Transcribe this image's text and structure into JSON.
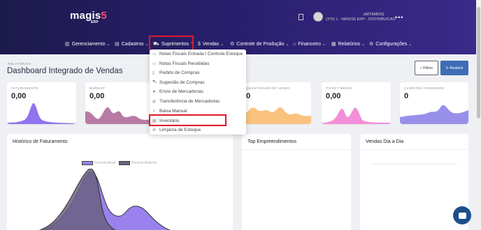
{
  "brand": {
    "name": "magis",
    "number": "5",
    "suffix": "ERP"
  },
  "user": {
    "name": "(ARTEMIOS)",
    "company": "(375) 1 - MAGIS5 ERP - DISTRIBUICAO"
  },
  "nav": [
    {
      "label": "Gerenciamento",
      "icon": "chart-icon"
    },
    {
      "label": "Cadastros",
      "icon": "list-icon"
    },
    {
      "label": "Suprimentos",
      "icon": "truck-icon"
    },
    {
      "label": "Vendas",
      "icon": "dollar-icon"
    },
    {
      "label": "Controle de Produção",
      "icon": "factory-icon"
    },
    {
      "label": "Financeiro",
      "icon": "bank-icon"
    },
    {
      "label": "Relatórios",
      "icon": "report-icon"
    },
    {
      "label": "Configurações",
      "icon": "gear-icon"
    }
  ],
  "breadcrumb": "RELATÓRIOS",
  "page_title": "Dashboard Integrado de Vendas",
  "buttons": {
    "filtros": "Filtros",
    "atualizar": "Atualizar"
  },
  "cards": [
    {
      "label": "FATURAMENTO",
      "value": "0,00",
      "color": "#7b5ce6"
    },
    {
      "label": "MARKUP",
      "value": "0,00",
      "color": "#b06a9a"
    },
    {
      "label": "",
      "value": "",
      "color": "#d4c2e8"
    },
    {
      "label": "QUANTIDADE DE VENDA",
      "value": "0",
      "color": "#f7b86a"
    },
    {
      "label": "TICKET MÉDIO",
      "value": "0,00",
      "color": "#f07ad0"
    },
    {
      "label": "CLIENTES ATENDIDOS",
      "value": "0",
      "color": "#8f86e8"
    }
  ],
  "panels": [
    {
      "title": "Histórico de Faturamento"
    },
    {
      "title": "Top Empreendimentos"
    },
    {
      "title": "Vendas Dia a Dia"
    }
  ],
  "legend": [
    {
      "label": "Período Atual",
      "color": "#9a82ee"
    },
    {
      "label": "Período Anterior",
      "color": "#6a6080"
    }
  ],
  "dropdown": [
    {
      "label": "Notas Fiscais Entrada / Controle Estoque",
      "icon": "note-icon"
    },
    {
      "label": "Notas Fiscais Recebidas",
      "icon": "note-icon"
    },
    {
      "label": "Pedido de Compras",
      "icon": "doc-icon"
    },
    {
      "label": "Sugestão de Compras",
      "icon": "cart-icon"
    },
    {
      "label": "Envio de Mercadorias",
      "icon": "send-icon"
    },
    {
      "label": "Transferência de Mercadorias",
      "icon": "transfer-icon"
    },
    {
      "label": "Baixa Manual",
      "icon": "check-icon"
    },
    {
      "label": "Inventário",
      "icon": "inventory-icon"
    },
    {
      "label": "Limpeza de Estoque",
      "icon": "clean-icon"
    }
  ]
}
